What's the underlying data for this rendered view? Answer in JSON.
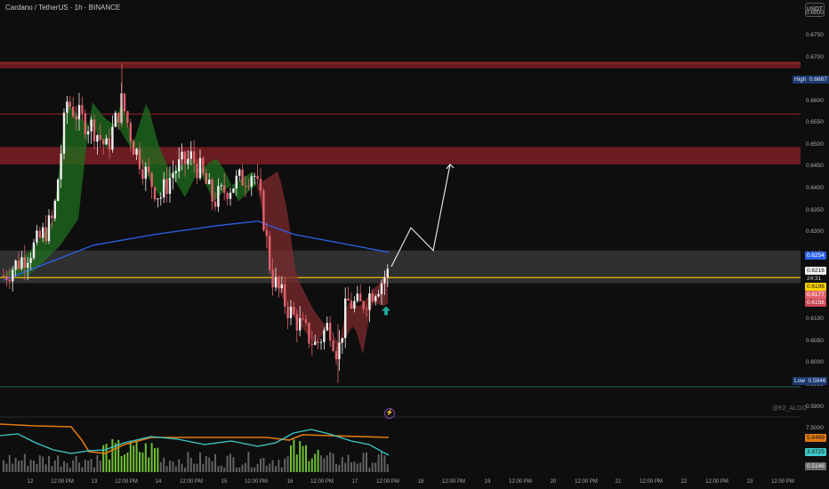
{
  "header": {
    "title": "Cardano / TetherUS · 1h · BINANCE",
    "currency": "USDT"
  },
  "colors": {
    "background": "#0e0e0e",
    "up_candle": "#f0f0f0",
    "down_candle": "#e0626a",
    "resistance_zone": "#7a1e24",
    "support_zone": "#3a3a3a",
    "key_level": "#ffd400",
    "ma_blue": "#2a62e8",
    "ribbon_bull": "#1f6f1f",
    "ribbon_bear": "#7d2a2e",
    "arrow_up": "#26a69a",
    "osc_orange": "#e07a10",
    "osc_cyan": "#3ec9c9",
    "osc_green_bar": "#7ad33a",
    "osc_gray_bar": "#6b6b6b"
  },
  "y_axis": {
    "ticks": [
      "0.6800",
      "0.6750",
      "0.6700",
      "0.6650",
      "0.6600",
      "0.6550",
      "0.6500",
      "0.6450",
      "0.6400",
      "0.6350",
      "0.6300",
      "0.6250",
      "0.6200",
      "0.6150",
      "0.6100",
      "0.6050",
      "0.6000",
      "0.5950",
      "0.5900"
    ]
  },
  "badges": {
    "high": {
      "label": "High",
      "value": "0.6687"
    },
    "ma": {
      "value": "0.6254"
    },
    "last_price": {
      "value": "0.6216"
    },
    "countdown": {
      "value": "24:31"
    },
    "key_level": {
      "value": "0.6196"
    },
    "ema_upper": {
      "value": "0.6177"
    },
    "ema_lower": {
      "value": "0.6156"
    },
    "low": {
      "label": "Low",
      "value": "0.5946"
    }
  },
  "oscillator": {
    "ticks": [
      "7.5000"
    ],
    "badges": {
      "orange": "5.6469",
      "cyan": "3.9725",
      "gray": "0.5146"
    }
  },
  "x_axis": {
    "labels": [
      "12",
      "12:00 PM",
      "13",
      "12:00 PM",
      "14",
      "12:00 PM",
      "15",
      "12:00 PM",
      "16",
      "12:00 PM",
      "17",
      "12:00 PM",
      "18",
      "12:00 PM",
      "19",
      "12:00 PM",
      "20",
      "12:00 PM",
      "21",
      "12:00 PM",
      "22",
      "12:00 PM",
      "23",
      "12:00 PM"
    ]
  },
  "watermark": "@E2_ALGO",
  "chart_data": {
    "type": "candlestick",
    "title": "Cardano / TetherUS · 1h · BINANCE",
    "xlabel": "",
    "ylabel": "",
    "ylim": [
      0.5885,
      0.6815
    ],
    "x_range": [
      "12",
      "23 12:00 PM"
    ],
    "grid": false,
    "series": [
      {
        "name": "",
        "kind": "close_approx",
        "x": [
          "12",
          "12 12:00",
          "13",
          "13 12:00",
          "14",
          "14 12:00",
          "15",
          "15 12:00",
          "16",
          "16 06:00",
          "16 12:00",
          "17",
          "17 06:00",
          "17 12:00"
        ],
        "values": [
          0.62,
          0.633,
          0.66,
          0.656,
          0.647,
          0.639,
          0.64,
          0.644,
          0.616,
          0.608,
          0.604,
          0.615,
          0.619,
          0.6216
        ]
      },
      {
        "name": "",
        "kind": "moving_average",
        "x": [
          "12",
          "13",
          "14",
          "15",
          "15 12:00",
          "16",
          "17 12:00"
        ],
        "values": [
          0.619,
          0.627,
          0.6295,
          0.6315,
          0.6325,
          0.6295,
          0.6254
        ]
      }
    ],
    "levels": [
      {
        "label": "High",
        "value": 0.6687
      },
      {
        "value": 0.6196
      },
      {
        "value": 0.6254
      },
      {
        "label": "Low",
        "value": 0.5946
      }
    ],
    "zones": [
      {
        "from": 0.6455,
        "to": 0.6495
      },
      {
        "from": 0.6675,
        "to": 0.669
      },
      {
        "from": 0.6183,
        "to": 0.6258
      }
    ],
    "projection": [
      {
        "x": "17 12:00",
        "y": 0.6221
      },
      {
        "x": "18 00:00",
        "y": 0.631
      },
      {
        "x": "18 06:00",
        "y": 0.6258
      },
      {
        "x": "18 12:00",
        "y": 0.6455
      }
    ]
  }
}
